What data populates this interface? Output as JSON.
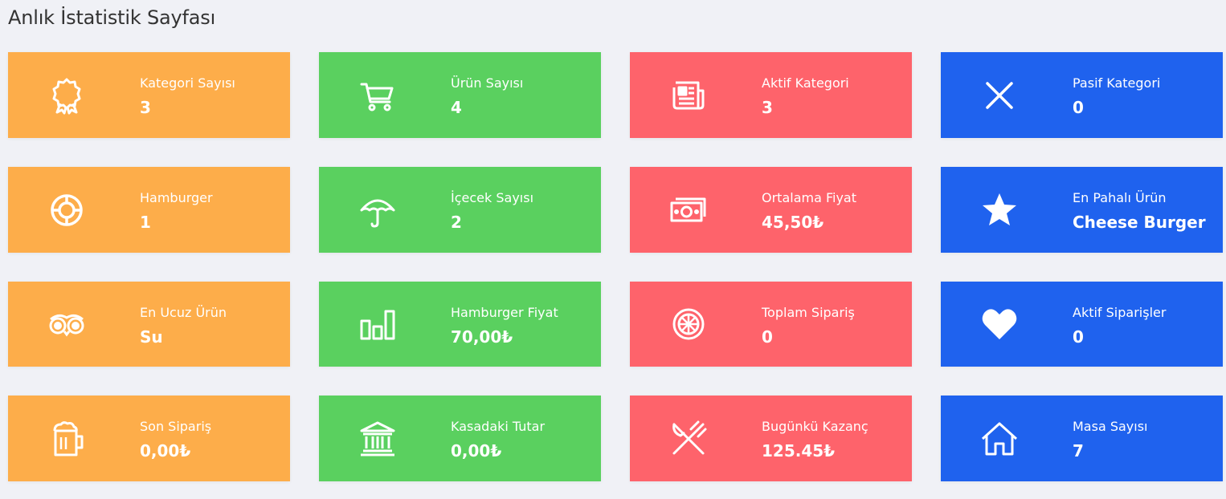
{
  "page": {
    "title": "Anlık İstatistik Sayfası"
  },
  "colors": {
    "orange": "#fdad4a",
    "green": "#5ad05f",
    "red": "#fe636b",
    "blue": "#1f62ee"
  },
  "cards": [
    {
      "label": "Kategori Sayısı",
      "value": "3",
      "icon": "award-icon",
      "color": "orange"
    },
    {
      "label": "Ürün Sayısı",
      "value": "4",
      "icon": "cart-icon",
      "color": "green"
    },
    {
      "label": "Aktif Kategori",
      "value": "3",
      "icon": "newspaper-icon",
      "color": "red"
    },
    {
      "label": "Pasif Kategori",
      "value": "0",
      "icon": "close-icon",
      "color": "blue"
    },
    {
      "label": "Hamburger",
      "value": "1",
      "icon": "lifebuoy-icon",
      "color": "orange"
    },
    {
      "label": "İçecek Sayısı",
      "value": "2",
      "icon": "umbrella-icon",
      "color": "green"
    },
    {
      "label": "Ortalama Fiyat",
      "value": "45,50₺",
      "icon": "money-icon",
      "color": "red"
    },
    {
      "label": "En Pahalı Ürün",
      "value": "Cheese Burger",
      "icon": "star-icon",
      "color": "blue"
    },
    {
      "label": "En Ucuz Ürün",
      "value": "Su",
      "icon": "owl-icon",
      "color": "orange"
    },
    {
      "label": "Hamburger Fiyat",
      "value": "70,00₺",
      "icon": "bar-chart-icon",
      "color": "green"
    },
    {
      "label": "Toplam Sipariş",
      "value": "0",
      "icon": "lemon-icon",
      "color": "red"
    },
    {
      "label": "Aktif Siparişler",
      "value": "0",
      "icon": "heart-icon",
      "color": "blue"
    },
    {
      "label": "Son Sipariş",
      "value": "0,00₺",
      "icon": "beer-mug-icon",
      "color": "orange"
    },
    {
      "label": "Kasadaki Tutar",
      "value": "0,00₺",
      "icon": "bank-icon",
      "color": "green"
    },
    {
      "label": "Bugünkü Kazanç",
      "value": "125.45₺",
      "icon": "cutlery-icon",
      "color": "red"
    },
    {
      "label": "Masa Sayısı",
      "value": "7",
      "icon": "home-icon",
      "color": "blue"
    }
  ]
}
